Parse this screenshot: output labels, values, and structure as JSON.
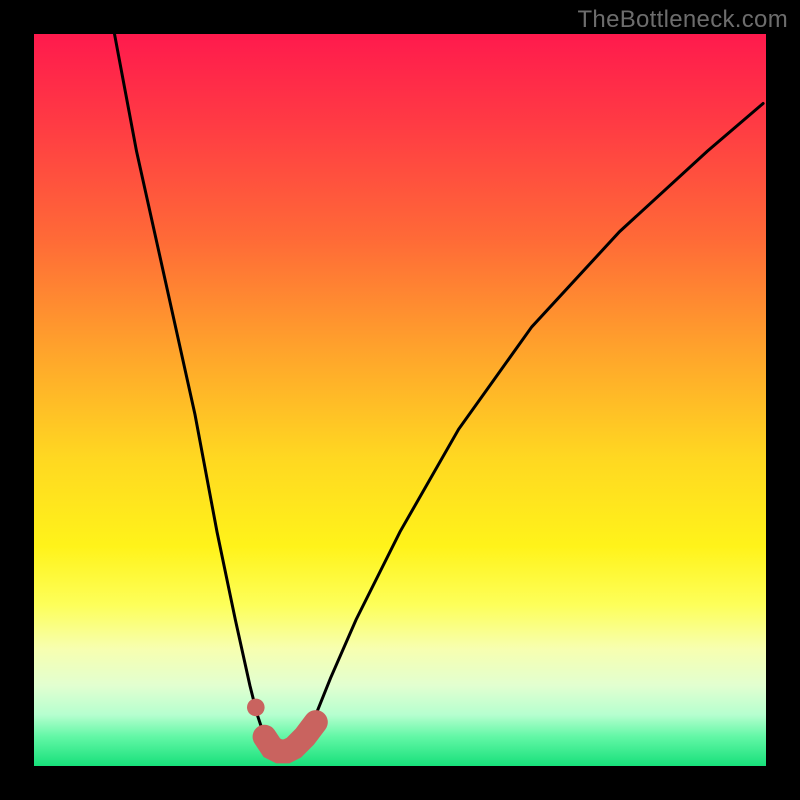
{
  "watermark": "TheBottleneck.com",
  "chart_data": {
    "type": "line",
    "title": "",
    "xlabel": "",
    "ylabel": "",
    "xlim": [
      0,
      100
    ],
    "ylim": [
      0,
      100
    ],
    "series": [
      {
        "name": "bottleneck-curve",
        "x": [
          11,
          14,
          18,
          22,
          25,
          27.5,
          29.5,
          30.5,
          31.5,
          32.5,
          33.5,
          34.5,
          35.5,
          37,
          38.5,
          40.5,
          44,
          50,
          58,
          68,
          80,
          92,
          99.6
        ],
        "y": [
          100,
          84,
          66,
          48,
          32,
          20,
          11,
          7,
          4,
          2.5,
          2,
          2,
          2.5,
          4,
          7,
          12,
          20,
          32,
          46,
          60,
          73,
          84,
          90.5
        ]
      }
    ],
    "markers": [
      {
        "name": "left-marker-dot",
        "x": 30.3,
        "y": 8,
        "r": 1.2,
        "color": "#c9635f"
      }
    ],
    "highlight_band": {
      "name": "green-zone",
      "x_start": 31,
      "x_end": 39,
      "color": "#c9635f"
    },
    "gradient_stops": [
      {
        "pos": 0,
        "color": "#ff1a4d",
        "meaning": "worst"
      },
      {
        "pos": 50,
        "color": "#ffe41f",
        "meaning": "mid"
      },
      {
        "pos": 100,
        "color": "#17e07a",
        "meaning": "best"
      }
    ]
  }
}
